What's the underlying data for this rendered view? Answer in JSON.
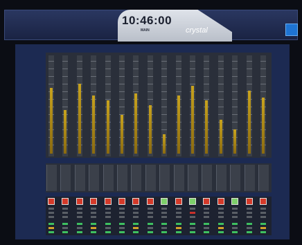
{
  "header": {
    "time": "10:46:00",
    "mode": "MAIN",
    "brand": "crystal"
  },
  "channels": [
    {
      "level": 0.68,
      "button": "red"
    },
    {
      "level": 0.45,
      "button": "red"
    },
    {
      "level": 0.72,
      "button": "red"
    },
    {
      "level": 0.6,
      "button": "red"
    },
    {
      "level": 0.55,
      "button": "red"
    },
    {
      "level": 0.4,
      "button": "red"
    },
    {
      "level": 0.62,
      "button": "red"
    },
    {
      "level": 0.5,
      "button": "red"
    },
    {
      "level": 0.2,
      "button": "green"
    },
    {
      "level": 0.6,
      "button": "red"
    },
    {
      "level": 0.7,
      "button": "green"
    },
    {
      "level": 0.55,
      "button": "red"
    },
    {
      "level": 0.35,
      "button": "red"
    },
    {
      "level": 0.25,
      "button": "green"
    },
    {
      "level": 0.65,
      "button": "red"
    },
    {
      "level": 0.58,
      "button": "red"
    }
  ],
  "colors": {
    "panel": "#1c2a52",
    "meter_fill": "#c8a31e",
    "button_red": "#d43a2a",
    "button_green": "#7dcf6a"
  },
  "icons": {
    "corner_logo": "broadcast-logo-icon"
  }
}
